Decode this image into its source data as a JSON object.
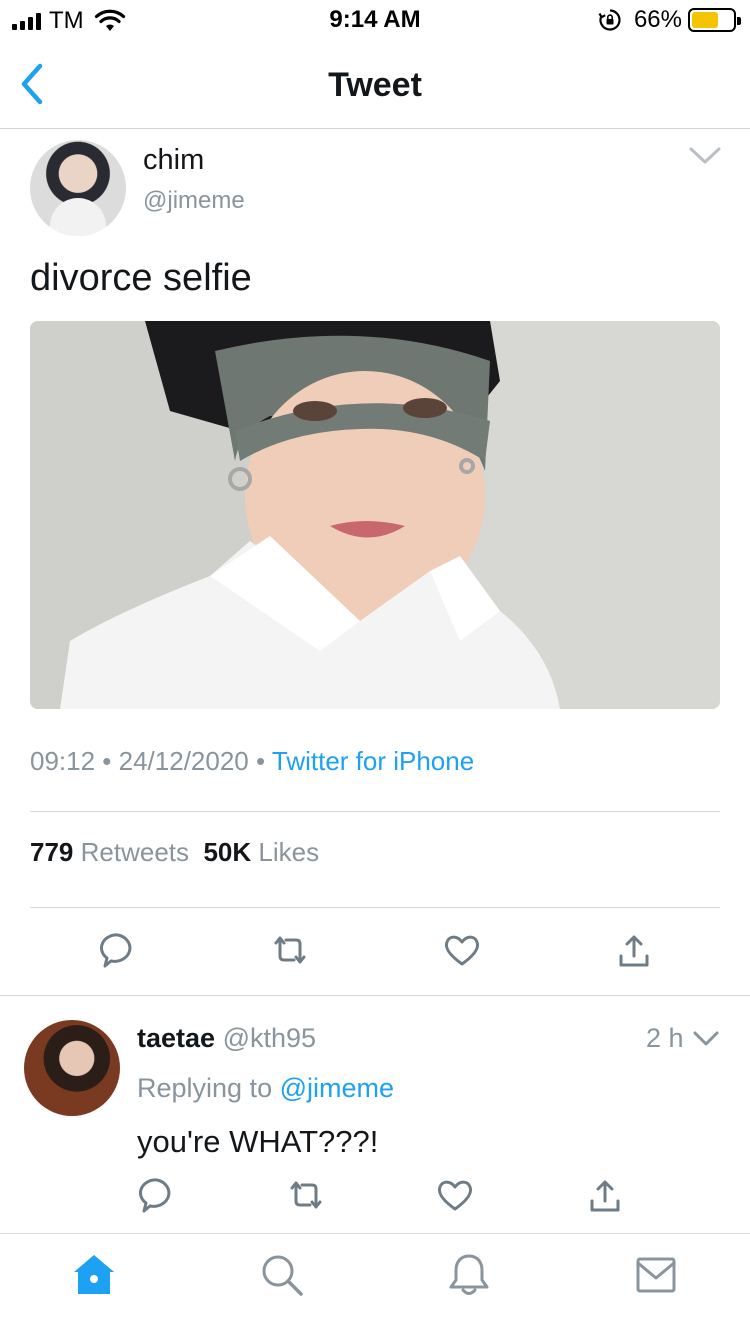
{
  "status_bar": {
    "carrier": "TM",
    "time": "9:14 AM",
    "battery_percent": "66%",
    "battery_level": 0.66,
    "battery_color": "#f5c400",
    "icons": [
      "signal-icon",
      "wifi-icon",
      "rotation-lock-icon",
      "battery-icon"
    ]
  },
  "nav": {
    "title": "Tweet",
    "back_icon": "chevron-left-icon"
  },
  "tweet": {
    "name": "chim",
    "handle": "@jimeme",
    "text": "divorce selfie",
    "time": "09:12",
    "sep1": " • ",
    "date": "24/12/2020",
    "sep2": " • ",
    "client": "Twitter for iPhone",
    "retweets_count": "779",
    "retweets_label": "Retweets",
    "likes_count": "50K",
    "likes_label": "Likes",
    "actions": [
      "reply-icon",
      "retweet-icon",
      "like-icon",
      "share-icon"
    ]
  },
  "reply": {
    "name": "taetae",
    "handle": "@kth95",
    "time": "2 h",
    "replying_prefix": "Replying to ",
    "replying_to": "@jimeme",
    "text": "you're WHAT???!",
    "actions": [
      "reply-icon",
      "retweet-icon",
      "like-icon",
      "share-icon"
    ]
  },
  "tabbar": {
    "tabs": [
      "home-icon",
      "search-icon",
      "notifications-icon",
      "messages-icon"
    ],
    "active": "home-icon"
  },
  "colors": {
    "accent": "#1da1f2",
    "text": "#14171a",
    "secondary": "#8a949c",
    "divider": "#d8dcdf"
  }
}
